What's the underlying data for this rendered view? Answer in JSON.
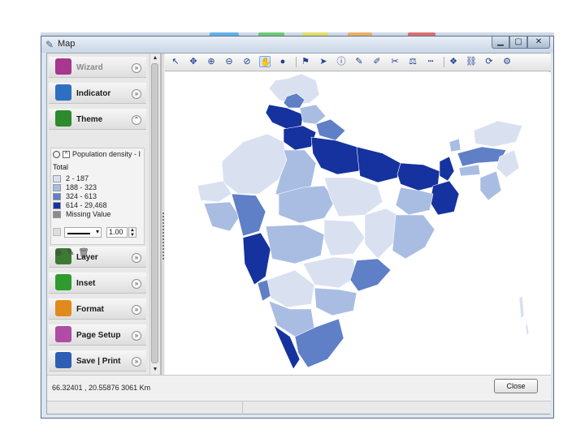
{
  "window": {
    "title": "Map",
    "min_glyph": "▁",
    "max_glyph": "▢",
    "close_glyph": "✕"
  },
  "sidebar": {
    "sections": [
      {
        "label": "Wizard",
        "icon": "wizard-icon",
        "color": "#a8378f",
        "state": "collapsed",
        "enabled": false
      },
      {
        "label": "Indicator",
        "icon": "indicator-icon",
        "color": "#2f6fc2",
        "state": "collapsed",
        "enabled": true
      },
      {
        "label": "Theme",
        "icon": "theme-icon",
        "color": "#2d8a2d",
        "state": "expanded",
        "enabled": true
      },
      {
        "label": "Layer",
        "icon": "layer-icon",
        "color": "#3c7a33",
        "state": "collapsed",
        "enabled": true
      },
      {
        "label": "Inset",
        "icon": "inset-icon",
        "color": "#2e9b2e",
        "state": "collapsed",
        "enabled": true
      },
      {
        "label": "Format",
        "icon": "format-icon",
        "color": "#e08a1e",
        "state": "collapsed",
        "enabled": true
      },
      {
        "label": "Page Setup",
        "icon": "page-setup-icon",
        "color": "#b04ca3",
        "state": "collapsed",
        "enabled": true
      },
      {
        "label": "Save | Print",
        "icon": "save-print-icon",
        "color": "#2e5fb4",
        "state": "collapsed",
        "enabled": true
      }
    ],
    "theme": {
      "layer_name": "Population density - I",
      "legend_title": "Total",
      "legend": [
        {
          "label": "2 - 187",
          "color": "#d9e1f1"
        },
        {
          "label": "188 - 323",
          "color": "#a9bde3"
        },
        {
          "label": "324 - 613",
          "color": "#5f7fc6"
        },
        {
          "label": "614 - 29,468",
          "color": "#15329e"
        },
        {
          "label": "Missing Value",
          "color": "#8c8c8c"
        }
      ],
      "line_width": "1.00"
    },
    "mini_tools": [
      "add-icon",
      "edit-icon",
      "delete-icon"
    ]
  },
  "toolbar": {
    "tools": [
      {
        "name": "select-tool-icon",
        "glyph": "↖"
      },
      {
        "name": "pan-arrows-icon",
        "glyph": "✥"
      },
      {
        "name": "zoom-in-icon",
        "glyph": "⊕"
      },
      {
        "name": "zoom-out-icon",
        "glyph": "⊖"
      },
      {
        "name": "zoom-extent-icon",
        "glyph": "⊘"
      },
      {
        "name": "hand-pan-icon",
        "glyph": "✋",
        "active": true
      },
      {
        "name": "globe-icon",
        "glyph": "●"
      },
      {
        "name": "label-icon",
        "glyph": "⚑"
      },
      {
        "name": "pointer-icon",
        "glyph": "➤"
      },
      {
        "name": "info-icon",
        "glyph": "ⓘ"
      },
      {
        "name": "draw-line-icon",
        "glyph": "✎"
      },
      {
        "name": "draw-poly-icon",
        "glyph": "✐"
      },
      {
        "name": "eraser-icon",
        "glyph": "✂"
      },
      {
        "name": "measure-icon",
        "glyph": "⚖"
      },
      {
        "name": "scale-bar-icon",
        "glyph": "┉"
      },
      {
        "name": "north-arrow-icon",
        "glyph": "❖"
      },
      {
        "name": "link-icon",
        "glyph": "⛓"
      },
      {
        "name": "refresh-icon",
        "glyph": "⟳"
      },
      {
        "name": "settings-icon",
        "glyph": "⚙"
      }
    ]
  },
  "status": {
    "coords": "66.32401 , 20.55876   3061 Km",
    "close_label": "Close"
  },
  "colors": {
    "class1": "#d9e1f1",
    "class2": "#a9bde3",
    "class3": "#5f7fc6",
    "class4": "#15329e",
    "border": "#ffffff"
  }
}
